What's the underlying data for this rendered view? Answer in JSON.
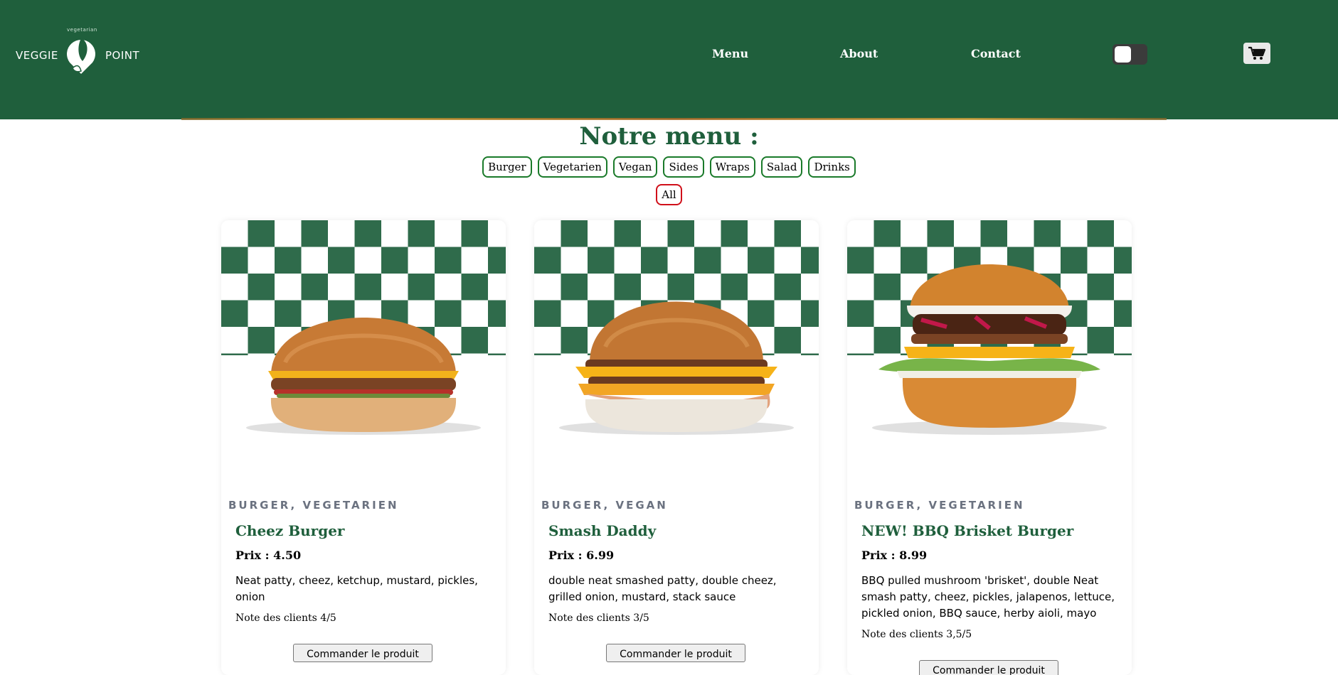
{
  "brand": {
    "left": "VEGGIE",
    "right": "POINT",
    "sub": "vegetarian"
  },
  "nav": {
    "menu": "Menu",
    "about": "About",
    "contact": "Contact"
  },
  "icons": {
    "cart": "cart-icon",
    "theme_toggle": "toggle-icon"
  },
  "colors": {
    "header": "#1f5f3c",
    "accent_green": "#1a7a2a",
    "active_red": "#d0101a",
    "title": "#1f5f3c"
  },
  "page": {
    "title": "Notre menu :"
  },
  "filters": [
    "Burger",
    "Vegetarien",
    "Vegan",
    "Sides",
    "Wraps",
    "Salad",
    "Drinks"
  ],
  "filter_all": "All",
  "products": [
    {
      "category": "BURGER, VEGETARIEN",
      "name": "Cheez Burger",
      "price": "Prix : 4.50",
      "description": "Neat patty, cheez, ketchup, mustard, pickles, onion",
      "rating": "Note des clients 4/5",
      "button": "Commander le produit"
    },
    {
      "category": "BURGER, VEGAN",
      "name": "Smash Daddy",
      "price": "Prix : 6.99",
      "description": "double neat smashed patty, double cheez, grilled onion, mustard, stack sauce",
      "rating": "Note des clients 3/5",
      "button": "Commander le produit"
    },
    {
      "category": "BURGER, VEGETARIEN",
      "name": "NEW! BBQ Brisket Burger",
      "price": "Prix : 8.99",
      "description": "BBQ pulled mushroom 'brisket', double Neat smash patty, cheez, pickles, jalapenos, lettuce, pickled onion, BBQ sauce, herby aioli, mayo",
      "rating": "Note des clients 3,5/5",
      "button": "Commander le produit"
    }
  ]
}
